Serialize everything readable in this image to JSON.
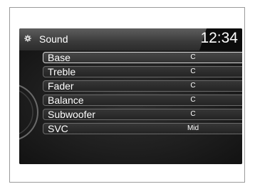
{
  "header": {
    "title": "Sound",
    "clock": "12:34",
    "icon": "settings-gear-icon"
  },
  "menu": {
    "items": [
      {
        "label": "Base",
        "value": "C",
        "selected": true
      },
      {
        "label": "Treble",
        "value": "C"
      },
      {
        "label": "Fader",
        "value": "C"
      },
      {
        "label": "Balance",
        "value": "C"
      },
      {
        "label": "Subwoofer",
        "value": "C"
      },
      {
        "label": "SVC",
        "value": "Mid"
      }
    ]
  },
  "colors": {
    "screen_bg": "#161616",
    "selected_border": "#d6d6d6",
    "text": "#ffffff"
  }
}
